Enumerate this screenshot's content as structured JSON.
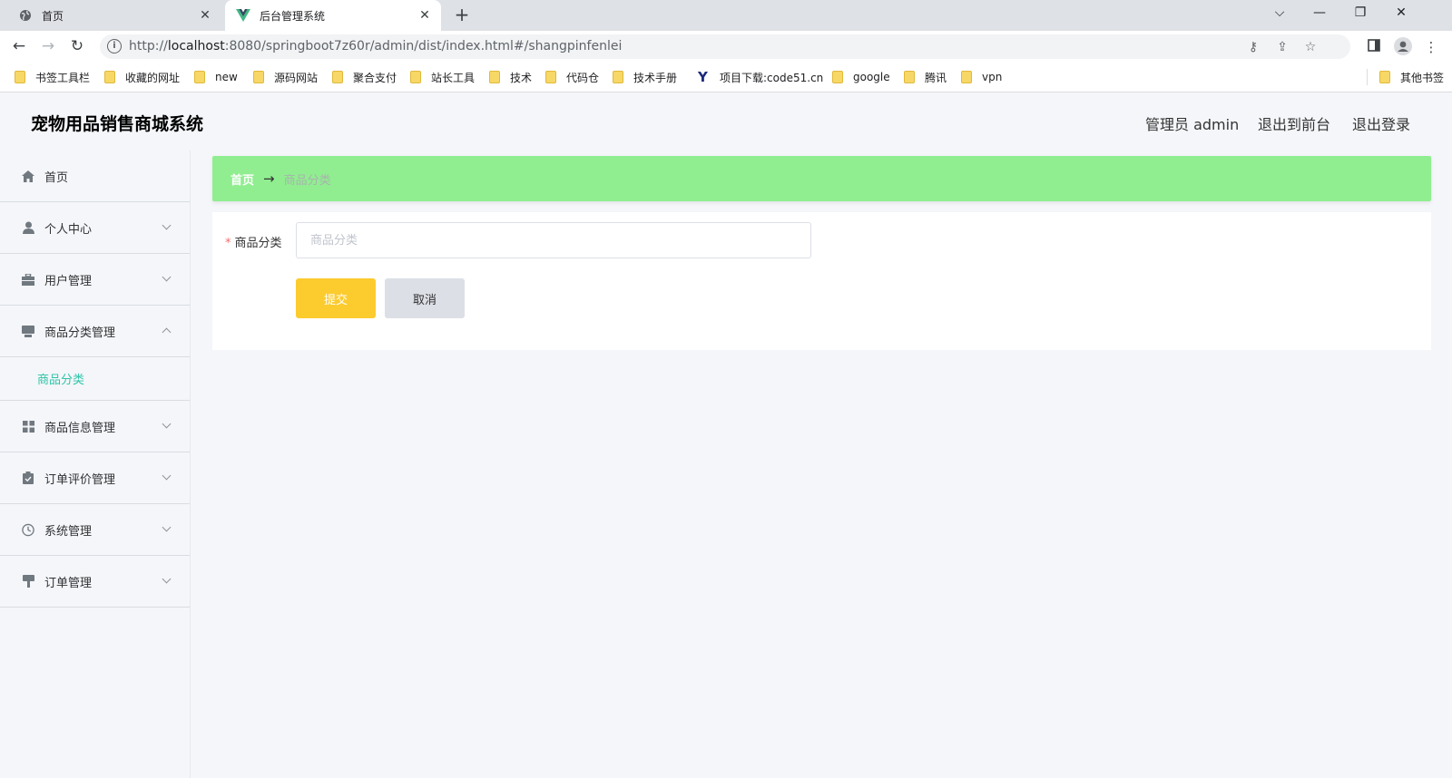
{
  "browser": {
    "tabs": [
      {
        "title": "首页",
        "active": false
      },
      {
        "title": "后台管理系统",
        "active": true
      }
    ],
    "url_prefix": "http://",
    "url_host": "localhost",
    "url_path": ":8080/springboot7z60r/admin/dist/index.html#/shangpinfenlei",
    "bookmarks": [
      "书签工具栏",
      "收藏的网址",
      "new",
      "源码网站",
      "聚合支付",
      "站长工具",
      "技术",
      "代码仓",
      "技术手册",
      "项目下载:code51.cn",
      "google",
      "腾讯",
      "vpn"
    ],
    "bookmarks_other": "其他书签"
  },
  "header": {
    "title": "宠物用品销售商城系统",
    "admin_label": "管理员 admin",
    "to_front": "退出到前台",
    "logout": "退出登录"
  },
  "sidebar": {
    "items": [
      {
        "label": "首页",
        "icon": "home-icon"
      },
      {
        "label": "个人中心",
        "icon": "user-icon"
      },
      {
        "label": "用户管理",
        "icon": "briefcase-icon"
      },
      {
        "label": "商品分类管理",
        "icon": "category-icon",
        "expanded": true,
        "children": [
          {
            "label": "商品分类",
            "active": true
          }
        ]
      },
      {
        "label": "商品信息管理",
        "icon": "grid-icon"
      },
      {
        "label": "订单评价管理",
        "icon": "clipboard-icon"
      },
      {
        "label": "系统管理",
        "icon": "clock-icon"
      },
      {
        "label": "订单管理",
        "icon": "brush-icon"
      }
    ]
  },
  "breadcrumb": {
    "home": "首页",
    "current": "商品分类"
  },
  "form": {
    "field_label": "商品分类",
    "required_mark": "*",
    "input_value": "",
    "input_placeholder": "商品分类",
    "submit_label": "提交",
    "cancel_label": "取消"
  },
  "colors": {
    "breadcrumb_bg": "#90ee90",
    "submit_bg": "#fccb2e",
    "active_menu": "#2ec4a8"
  }
}
